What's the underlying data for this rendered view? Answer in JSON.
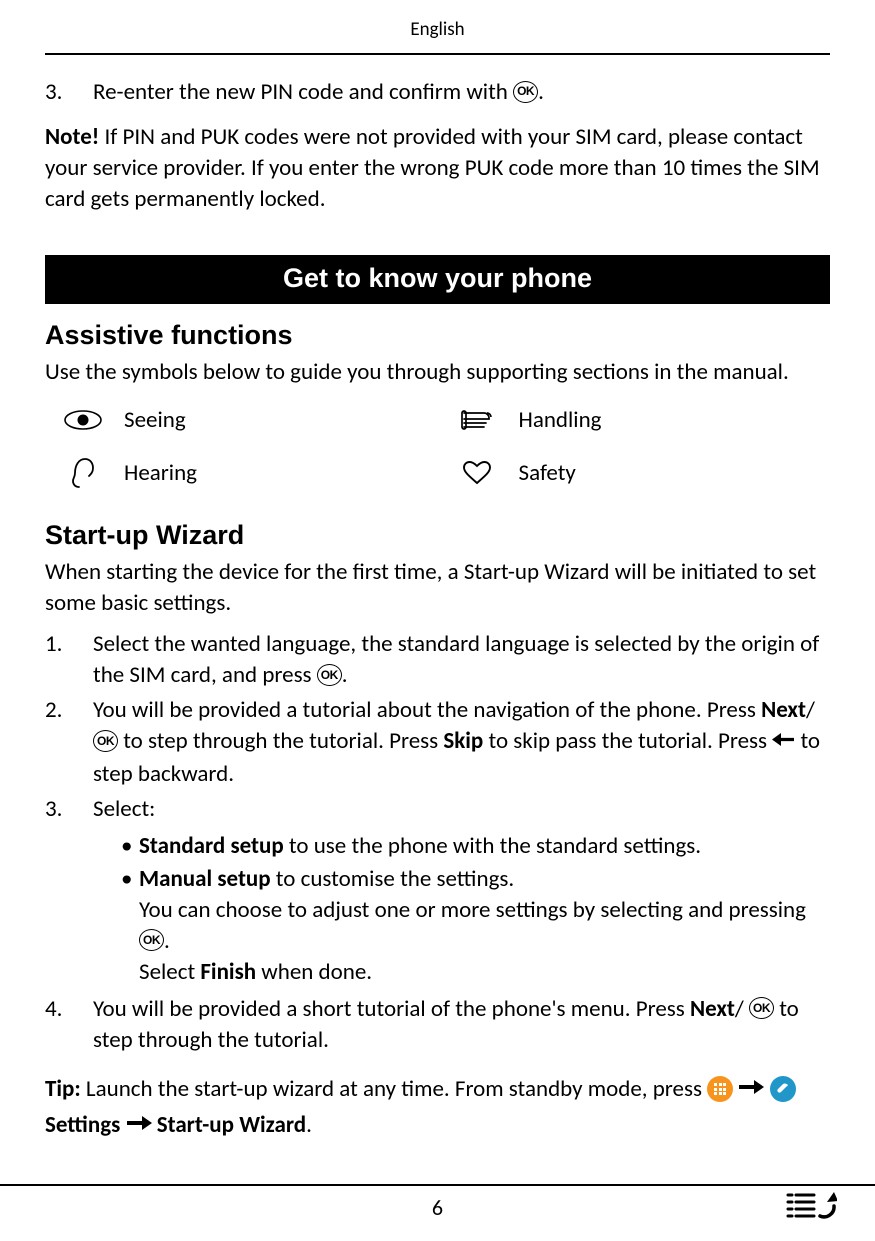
{
  "header": "English",
  "step3": {
    "num": "3.",
    "text_before": "Re-enter the new PIN code and confirm with",
    "text_after": "."
  },
  "note": {
    "label": "Note!",
    "text": " If PIN and PUK codes were not provided with your SIM card, please contact your service provider. If you enter the wrong PUK code more than 10 times the SIM card gets permanently locked."
  },
  "banner": "Get to know your phone",
  "assistive": {
    "heading": "Assistive functions",
    "intro": "Use the symbols below to guide you through supporting sections in the manual.",
    "items": {
      "seeing": "Seeing",
      "handling": "Handling",
      "hearing": "Hearing",
      "safety": "Safety"
    }
  },
  "wizard": {
    "heading": "Start-up Wizard",
    "intro": "When starting the device for the first time, a Start-up Wizard will be initiated to set some basic settings.",
    "steps": [
      {
        "num": "1.",
        "pre": "Select the wanted language, the standard language is selected by the origin of the SIM card, and press",
        "post": "."
      },
      {
        "num": "2.",
        "a": "You will be provided a tutorial about the navigation of the phone. Press ",
        "next": "Next",
        "slash": "/",
        "b": " to step through the tutorial. Press ",
        "skip": "Skip",
        "c": " to skip pass the tutorial. Press ",
        "d": " to step backward."
      },
      {
        "num": "3.",
        "label": "Select:",
        "sub": [
          {
            "bold": "Standard setup",
            "rest": " to use the phone with the standard settings."
          },
          {
            "bold": "Manual setup",
            "rest": " to customise the settings.",
            "line2a": "You can choose to adjust one or more settings by selecting and pressing ",
            "line2b": ".",
            "line3a": "Select ",
            "finish": "Finish",
            "line3b": " when done."
          }
        ]
      },
      {
        "num": "4.",
        "a": "You will be provided a short tutorial of the phone's menu. Press ",
        "next": "Next",
        "slash": "/",
        "b": " to step through the tutorial."
      }
    ]
  },
  "tip": {
    "label": "Tip:",
    "a": " Launch the start-up wizard at any time. From standby mode, press ",
    "settings": "Settings",
    "wizard": "Start-up Wizard",
    "period": "."
  },
  "page_number": "6"
}
